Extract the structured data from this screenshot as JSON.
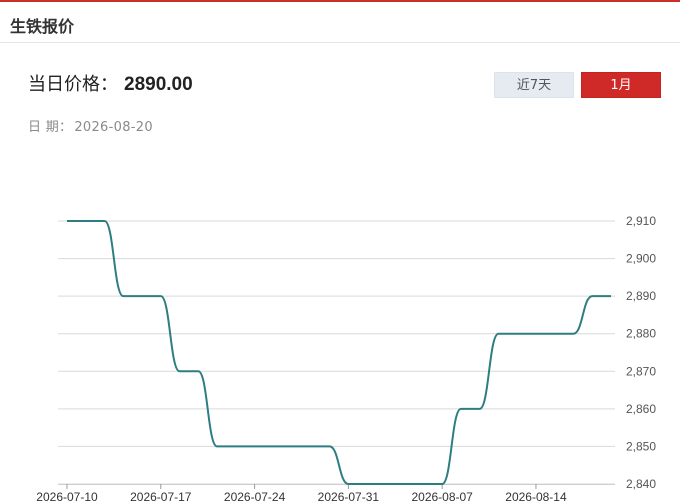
{
  "header": {
    "title": "生铁报价"
  },
  "price": {
    "label": "当日价格：",
    "value": "2890.00"
  },
  "date": {
    "label": "日 期：",
    "value": "2026-08-20"
  },
  "range_buttons": {
    "week": "近7天",
    "month": "1月",
    "active": "month"
  },
  "colors": {
    "accent": "#cf2a27",
    "line": "#2e7d80",
    "grid": "#d9d9d9"
  },
  "chart_data": {
    "type": "line",
    "x": [
      "2026-07-10",
      "2026-07-13",
      "2026-07-14",
      "2026-07-15",
      "2026-07-16",
      "2026-07-17",
      "2026-07-20",
      "2026-07-21",
      "2026-07-22",
      "2026-07-23",
      "2026-07-24",
      "2026-07-27",
      "2026-07-28",
      "2026-07-29",
      "2026-07-30",
      "2026-07-31",
      "2026-08-03",
      "2026-08-04",
      "2026-08-05",
      "2026-08-06",
      "2026-08-07",
      "2026-08-10",
      "2026-08-11",
      "2026-08-12",
      "2026-08-13",
      "2026-08-14",
      "2026-08-17",
      "2026-08-18",
      "2026-08-19",
      "2026-08-20"
    ],
    "values": [
      2910,
      2910,
      2910,
      2890,
      2890,
      2890,
      2870,
      2870,
      2850,
      2850,
      2850,
      2850,
      2850,
      2850,
      2850,
      2840,
      2840,
      2840,
      2840,
      2840,
      2840,
      2860,
      2860,
      2880,
      2880,
      2880,
      2880,
      2880,
      2890,
      2890
    ],
    "x_tick_labels": [
      "2026-07-10",
      "2026-07-17",
      "2026-07-24",
      "2026-07-31",
      "2026-08-07",
      "2026-08-14"
    ],
    "y_tick_labels": [
      "2,840",
      "2,850",
      "2,860",
      "2,870",
      "2,880",
      "2,890",
      "2,900",
      "2,910"
    ],
    "ylim": [
      2840,
      2910
    ],
    "grid": true,
    "y_axis_side": "right",
    "title": "",
    "xlabel": "",
    "ylabel": ""
  }
}
